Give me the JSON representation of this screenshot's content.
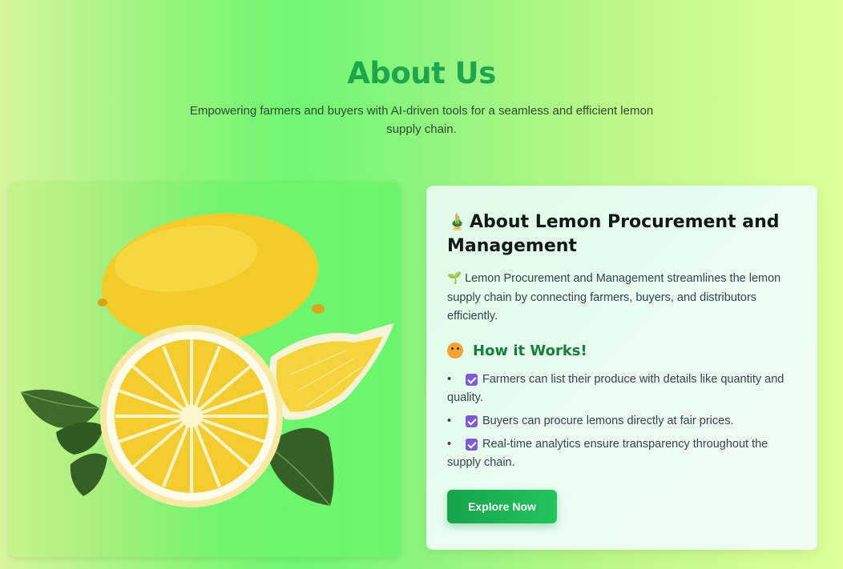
{
  "header": {
    "title": "About Us",
    "subtitle": "Empowering farmers and buyers with AI-driven tools for a seamless and efficient lemon supply chain."
  },
  "image": {
    "subject": "lemons-with-mint-leaves"
  },
  "card": {
    "heading_icon": "bamboo-icon",
    "heading": "About Lemon Procurement and Management",
    "intro_icon": "seedling-icon",
    "intro": "Lemon Procurement and Management streamlines the lemon supply chain by connecting farmers, buyers, and distributors efficiently.",
    "how_icon": "thinking-face-icon",
    "how_title": "How it Works!",
    "features": [
      "Farmers can list their produce with details like quantity and quality.",
      "Buyers can procure lemons directly at fair prices.",
      "Real-time analytics ensure transparency throughout the supply chain."
    ],
    "button_label": "Explore Now"
  },
  "colors": {
    "accent": "#1ea64e",
    "button": "#22c55e",
    "checkbox": "#7b5cd6"
  }
}
